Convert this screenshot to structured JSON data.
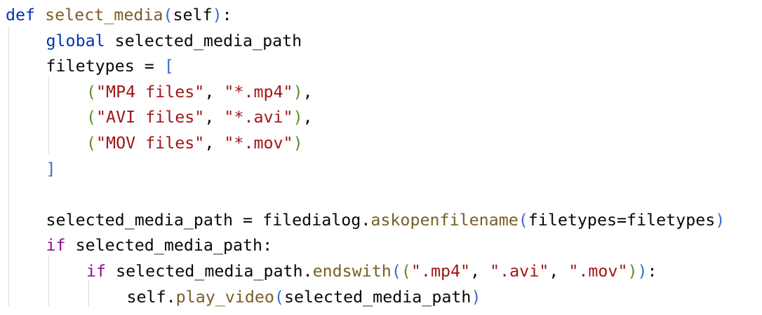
{
  "code": {
    "lines": [
      {
        "indent": 0,
        "tokens": [
          {
            "t": "def",
            "c": "kw"
          },
          {
            "t": " ",
            "c": "id"
          },
          {
            "t": "select_media",
            "c": "call"
          },
          {
            "t": "(",
            "c": "p1"
          },
          {
            "t": "self",
            "c": "id"
          },
          {
            "t": ")",
            "c": "p1"
          },
          {
            "t": ":",
            "c": "id"
          }
        ]
      },
      {
        "indent": 1,
        "tokens": [
          {
            "t": "global",
            "c": "kw"
          },
          {
            "t": " selected_media_path",
            "c": "id"
          }
        ]
      },
      {
        "indent": 1,
        "tokens": [
          {
            "t": "filetypes = ",
            "c": "id"
          },
          {
            "t": "[",
            "c": "p1"
          }
        ]
      },
      {
        "indent": 2,
        "tokens": [
          {
            "t": "(",
            "c": "p2"
          },
          {
            "t": "\"MP4 files\"",
            "c": "str"
          },
          {
            "t": ", ",
            "c": "id"
          },
          {
            "t": "\"*.mp4\"",
            "c": "str"
          },
          {
            "t": ")",
            "c": "p2"
          },
          {
            "t": ",",
            "c": "id"
          }
        ]
      },
      {
        "indent": 2,
        "tokens": [
          {
            "t": "(",
            "c": "p2"
          },
          {
            "t": "\"AVI files\"",
            "c": "str"
          },
          {
            "t": ", ",
            "c": "id"
          },
          {
            "t": "\"*.avi\"",
            "c": "str"
          },
          {
            "t": ")",
            "c": "p2"
          },
          {
            "t": ",",
            "c": "id"
          }
        ]
      },
      {
        "indent": 2,
        "tokens": [
          {
            "t": "(",
            "c": "p2"
          },
          {
            "t": "\"MOV files\"",
            "c": "str"
          },
          {
            "t": ", ",
            "c": "id"
          },
          {
            "t": "\"*.mov\"",
            "c": "str"
          },
          {
            "t": ")",
            "c": "p2"
          }
        ]
      },
      {
        "indent": 1,
        "tokens": [
          {
            "t": "]",
            "c": "p1"
          }
        ]
      },
      {
        "indent": 0,
        "tokens": []
      },
      {
        "indent": 1,
        "tokens": [
          {
            "t": "selected_media_path = filedialog.",
            "c": "id"
          },
          {
            "t": "askopenfilename",
            "c": "call"
          },
          {
            "t": "(",
            "c": "p1"
          },
          {
            "t": "filetypes=filetypes",
            "c": "id"
          },
          {
            "t": ")",
            "c": "p1"
          }
        ]
      },
      {
        "indent": 1,
        "tokens": [
          {
            "t": "if",
            "c": "kwc"
          },
          {
            "t": " selected_media_path:",
            "c": "id"
          }
        ]
      },
      {
        "indent": 2,
        "tokens": [
          {
            "t": "if",
            "c": "kwc"
          },
          {
            "t": " selected_media_path.",
            "c": "id"
          },
          {
            "t": "endswith",
            "c": "call"
          },
          {
            "t": "(",
            "c": "p1"
          },
          {
            "t": "(",
            "c": "p2"
          },
          {
            "t": "\".mp4\"",
            "c": "str"
          },
          {
            "t": ", ",
            "c": "id"
          },
          {
            "t": "\".avi\"",
            "c": "str"
          },
          {
            "t": ", ",
            "c": "id"
          },
          {
            "t": "\".mov\"",
            "c": "str"
          },
          {
            "t": ")",
            "c": "p2"
          },
          {
            "t": ")",
            "c": "p1"
          },
          {
            "t": ":",
            "c": "id"
          }
        ]
      },
      {
        "indent": 3,
        "tokens": [
          {
            "t": "self.",
            "c": "id"
          },
          {
            "t": "play_video",
            "c": "call"
          },
          {
            "t": "(",
            "c": "p1"
          },
          {
            "t": "selected_media_path",
            "c": "id"
          },
          {
            "t": ")",
            "c": "p1"
          }
        ]
      }
    ]
  }
}
